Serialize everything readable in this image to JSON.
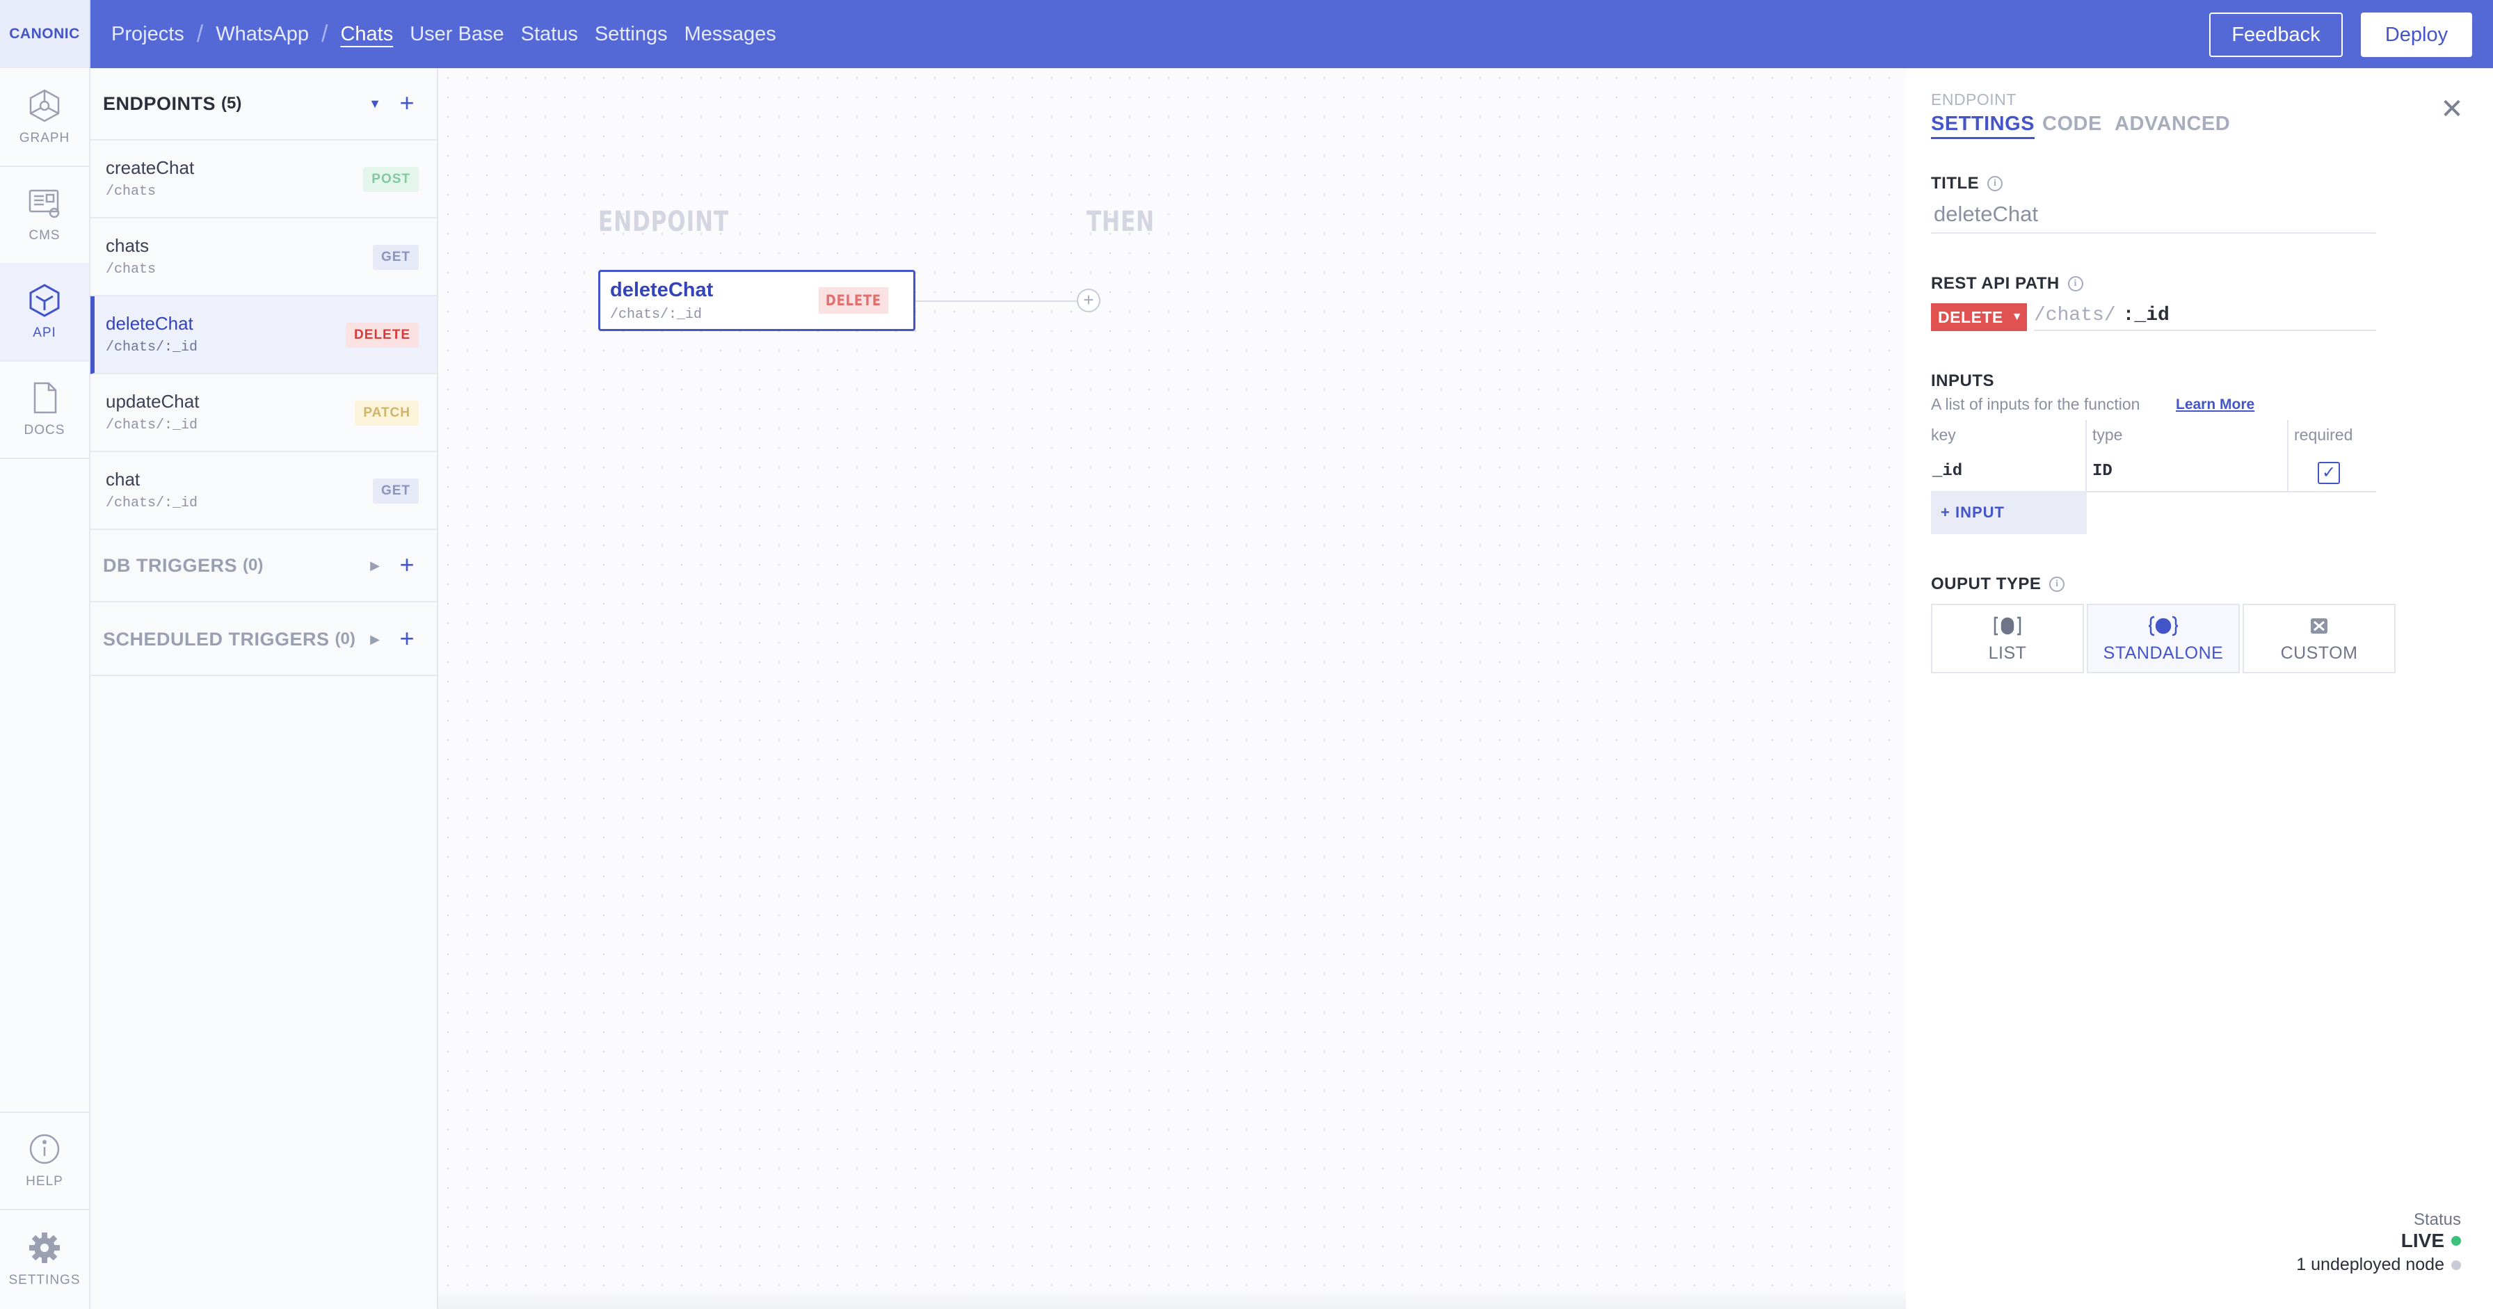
{
  "app": {
    "brand": "CANONIC"
  },
  "header": {
    "breadcrumbs": [
      "Projects",
      "WhatsApp"
    ],
    "nav": [
      {
        "label": "Chats",
        "active": true
      },
      {
        "label": "User Base",
        "active": false
      },
      {
        "label": "Status",
        "active": false
      },
      {
        "label": "Settings",
        "active": false
      },
      {
        "label": "Messages",
        "active": false
      }
    ],
    "feedback_label": "Feedback",
    "deploy_label": "Deploy"
  },
  "rail": {
    "items": [
      {
        "label": "GRAPH",
        "icon": "graph-icon"
      },
      {
        "label": "CMS",
        "icon": "cms-icon"
      },
      {
        "label": "API",
        "icon": "api-icon",
        "active": true
      },
      {
        "label": "DOCS",
        "icon": "docs-icon"
      }
    ],
    "bottom": [
      {
        "label": "HELP",
        "icon": "info-icon"
      },
      {
        "label": "SETTINGS",
        "icon": "gear-icon"
      }
    ]
  },
  "endpoints": {
    "title": "ENDPOINTS",
    "count": "(5)",
    "items": [
      {
        "name": "createChat",
        "path": "/chats",
        "method": "POST"
      },
      {
        "name": "chats",
        "path": "/chats",
        "method": "GET"
      },
      {
        "name": "deleteChat",
        "path": "/chats/:_id",
        "method": "DELETE",
        "active": true
      },
      {
        "name": "updateChat",
        "path": "/chats/:_id",
        "method": "PATCH"
      },
      {
        "name": "chat",
        "path": "/chats/:_id",
        "method": "GET"
      }
    ]
  },
  "db_triggers": {
    "title": "DB TRIGGERS",
    "count": "(0)"
  },
  "scheduled_triggers": {
    "title": "SCHEDULED TRIGGERS",
    "count": "(0)"
  },
  "canvas": {
    "col_endpoint": "ENDPOINT",
    "col_then": "THEN",
    "node": {
      "title": "deleteChat",
      "path": "/chats/:_id",
      "method": "DELETE"
    }
  },
  "settings": {
    "overline": "ENDPOINT",
    "tabs": [
      {
        "label": "SETTINGS",
        "active": true
      },
      {
        "label": "CODE",
        "active": false
      },
      {
        "label": "ADVANCED",
        "active": false
      }
    ],
    "title_label": "TITLE",
    "title_value": "deleteChat",
    "rest_label": "REST API PATH",
    "method": "DELETE",
    "path_prefix": "/chats/",
    "path_param": ":_id",
    "inputs_label": "INPUTS",
    "inputs_desc": "A list of inputs for the function",
    "learn_more": "Learn More",
    "table": {
      "headers": {
        "key": "key",
        "type": "type",
        "required": "required"
      },
      "rows": [
        {
          "key": "_id",
          "type": "ID",
          "required": true
        }
      ]
    },
    "add_input_label": "+ INPUT",
    "output_label": "OUPUT TYPE",
    "output_types": [
      {
        "label": "LIST",
        "icon": "list-icon"
      },
      {
        "label": "STANDALONE",
        "icon": "standalone-icon",
        "active": true
      },
      {
        "label": "CUSTOM",
        "icon": "custom-icon"
      }
    ]
  },
  "status": {
    "caption": "Status",
    "live": "LIVE",
    "live_color": "#3cc07a",
    "undeployed": "1 undeployed node",
    "undeployed_color": "#c9ccd6"
  },
  "colors": {
    "accent": "#4355c9",
    "header": "#5468d6",
    "delete": "#e05252"
  }
}
